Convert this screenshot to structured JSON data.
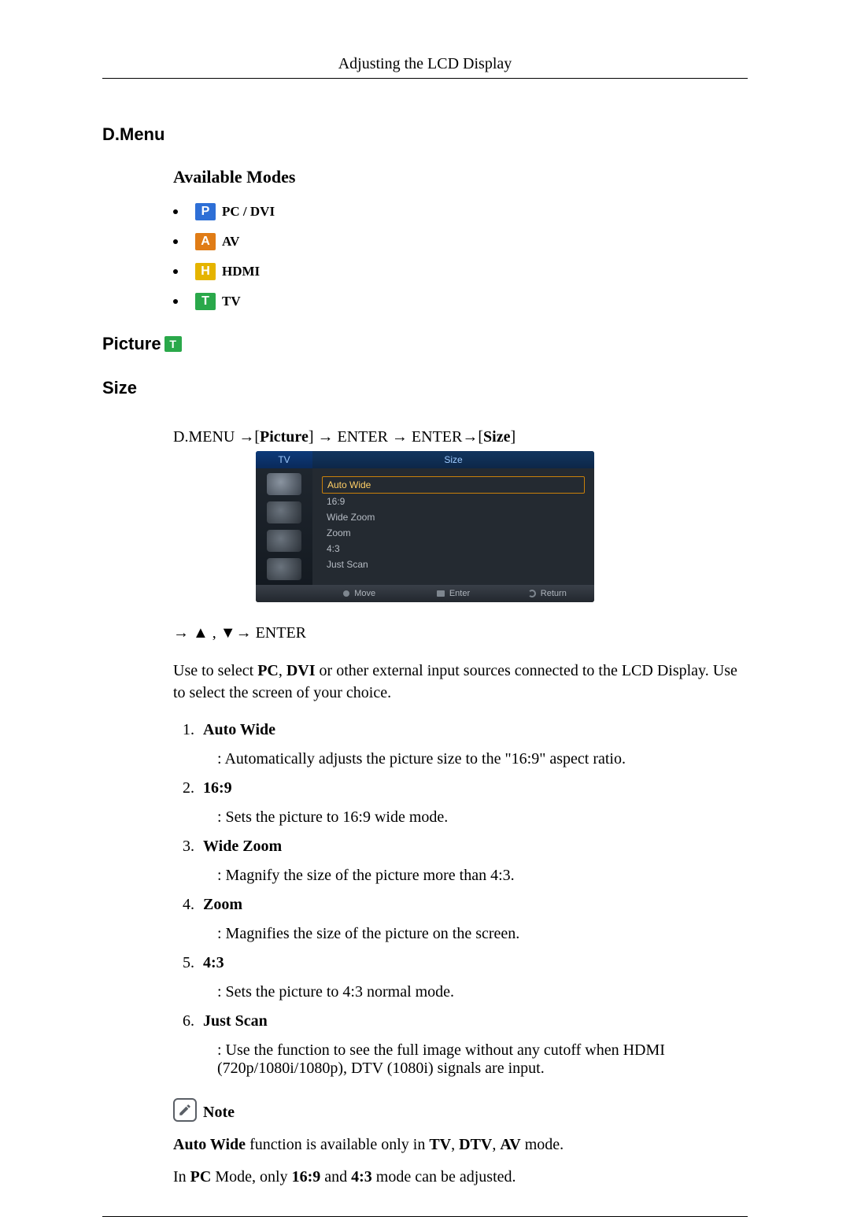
{
  "header": {
    "title": "Adjusting the LCD Display"
  },
  "section_dmenu": "D.Menu",
  "available_modes_title": "Available Modes",
  "modes": {
    "pc_dvi": {
      "glyph": "P",
      "label": "PC / DVI"
    },
    "av": {
      "glyph": "A",
      "label": "AV"
    },
    "hdmi": {
      "glyph": "H",
      "label": "HDMI"
    },
    "tv": {
      "glyph": "T",
      "label": "TV"
    }
  },
  "picture_heading": "Picture",
  "picture_icon_glyph": "T",
  "size_heading": "Size",
  "path": {
    "prefix": "D.MENU →[",
    "picture": "Picture",
    "mid": "] → ENTER → ENTER→[",
    "size": "Size",
    "suffix": "]"
  },
  "osd": {
    "head_left": "TV",
    "head_right": "Size",
    "items": [
      "Auto Wide",
      "16:9",
      "Wide Zoom",
      "Zoom",
      "4:3",
      "Just Scan"
    ],
    "foot_move": "Move",
    "foot_enter": "Enter",
    "foot_return": "Return"
  },
  "nav_line": "→ ▲ , ▼→ ENTER",
  "intro_para_1a": "Use to select ",
  "intro_para_pc": "PC",
  "intro_para_comma": ", ",
  "intro_para_dvi": "DVI",
  "intro_para_1b": " or other external input sources connected to the LCD Display. Use to select the screen of your choice.",
  "options": [
    {
      "name": "Auto Wide",
      "desc": ": Automatically adjusts the picture size to the \"16:9\" aspect ratio."
    },
    {
      "name": "16:9",
      "desc": ": Sets the picture to 16:9 wide mode."
    },
    {
      "name": "Wide Zoom",
      "desc": ": Magnify the size of the picture more than 4:3."
    },
    {
      "name": "Zoom",
      "desc": ": Magnifies the size of the picture on the screen."
    },
    {
      "name": "4:3",
      "desc": ": Sets the picture to 4:3 normal mode."
    },
    {
      "name": "Just Scan",
      "desc": ": Use the function to see the full image without any cutoff when HDMI (720p/1080i/1080p), DTV (1080i) signals are input."
    }
  ],
  "note_label": "Note",
  "note1": {
    "a": "Auto Wide",
    "b": " function is available only in ",
    "c": "TV",
    "d": ", ",
    "e": "DTV",
    "f": ", ",
    "g": "AV",
    "h": " mode."
  },
  "note2": {
    "a": "In ",
    "b": "PC",
    "c": " Mode, only ",
    "d": "16:9",
    "e": " and ",
    "f": "4:3",
    "g": " mode can be adjusted."
  }
}
